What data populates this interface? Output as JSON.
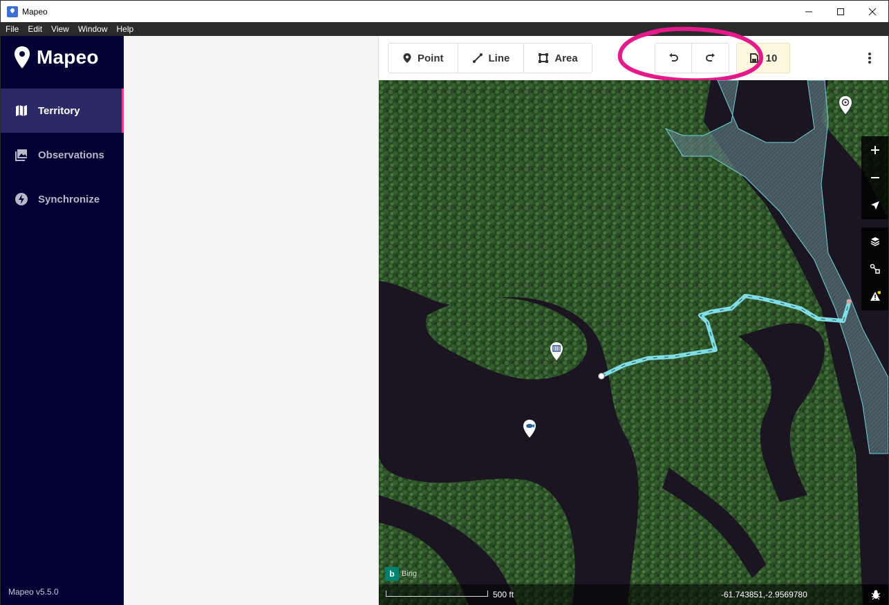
{
  "window": {
    "title": "Mapeo",
    "controls": {
      "minimize": "—",
      "maximize": "☐",
      "close": "✕"
    }
  },
  "menu": {
    "items": [
      "File",
      "Edit",
      "View",
      "Window",
      "Help"
    ]
  },
  "sidebar": {
    "brand": "Mapeo",
    "items": [
      {
        "label": "Territory",
        "icon": "map-icon",
        "active": true
      },
      {
        "label": "Observations",
        "icon": "photos-icon",
        "active": false
      },
      {
        "label": "Synchronize",
        "icon": "lightning-icon",
        "active": false
      }
    ],
    "version": "Mapeo v5.5.0"
  },
  "toolbar": {
    "tools": [
      {
        "label": "Point",
        "icon": "point-icon"
      },
      {
        "label": "Line",
        "icon": "line-icon"
      },
      {
        "label": "Area",
        "icon": "area-icon"
      }
    ],
    "undo_icon": "undo-icon",
    "redo_icon": "redo-icon",
    "save_count": "10",
    "highlight_color": "#e6198a"
  },
  "map": {
    "attribution": "Bing",
    "scale_label": "500 ft",
    "coordinates": "-61.743851,-2.9569780",
    "line_color": "#7fdde6",
    "controls": [
      "zoom-in-icon",
      "zoom-out-icon",
      "locate-icon",
      "layers-icon",
      "map-data-icon",
      "issues-icon"
    ]
  }
}
